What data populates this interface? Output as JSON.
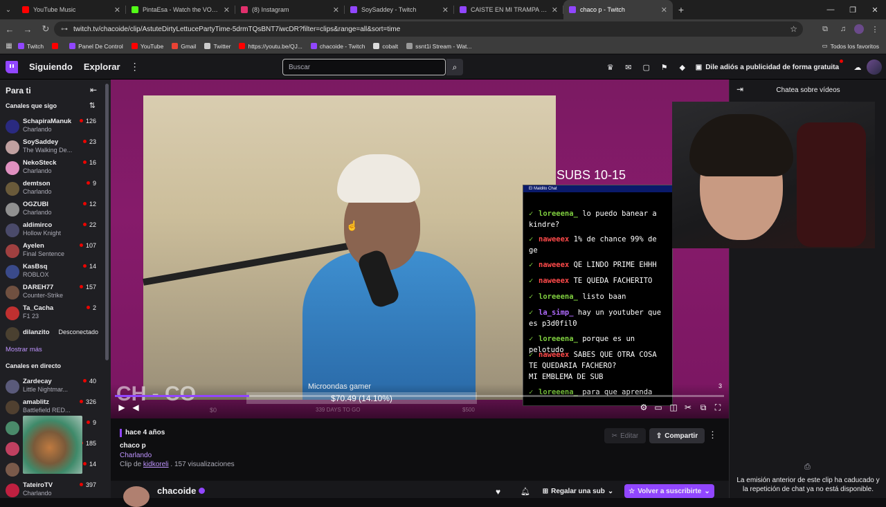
{
  "browser": {
    "tabs": [
      {
        "title": "YouTube Music",
        "color": "#ff0000"
      },
      {
        "title": "PintaEsa - Watch the VOD on K",
        "color": "#53fc18"
      },
      {
        "title": "(8) Instagram",
        "color": "#e1306c"
      },
      {
        "title": "SoySaddey - Twitch",
        "color": "#9146ff"
      },
      {
        "title": "CAISTE EN MI TRAMPA PERRA",
        "color": "#9146ff"
      },
      {
        "title": "chaco p - Twitch",
        "color": "#9146ff",
        "active": true
      }
    ],
    "url": "twitch.tv/chacoide/clip/AstuteDirtyLettucePartyTime-5drmTQsBNT7iwcDR?filter=clips&range=all&sort=time",
    "bookmarks": [
      {
        "label": "Twitch",
        "color": "#9146ff"
      },
      {
        "label": "",
        "color": "#ff0000"
      },
      {
        "label": "Panel De Control",
        "color": "#9146ff"
      },
      {
        "label": "YouTube",
        "color": "#ff0000"
      },
      {
        "label": "Gmail",
        "color": "#ea4335"
      },
      {
        "label": "Twitter",
        "color": "#cccccc"
      },
      {
        "label": "https://youtu.be/QJ...",
        "color": "#ff0000"
      },
      {
        "label": "chacoide - Twitch",
        "color": "#9146ff"
      },
      {
        "label": "cobalt",
        "color": "#dddddd"
      },
      {
        "label": "ssnt1i Stream - Wat...",
        "color": "#999999"
      }
    ],
    "all_favorites": "Todos los favoritos"
  },
  "topnav": {
    "following": "Siguiendo",
    "browse": "Explorar",
    "search_placeholder": "Buscar",
    "ad_free": "Dile adiós a publicidad de forma gratuita"
  },
  "sidebar": {
    "title": "Para ti",
    "followed_title": "Canales que sigo",
    "followed": [
      {
        "name": "SchapiraManuk",
        "game": "Charlando",
        "viewers": "126",
        "color": "#2a2a80"
      },
      {
        "name": "SoySaddey",
        "game": "The Walking De...",
        "viewers": "23",
        "color": "#c0a0a0"
      },
      {
        "name": "NekoSteck",
        "game": "Charlando",
        "viewers": "16",
        "color": "#e090c0"
      },
      {
        "name": "demtson",
        "game": "Charlando",
        "viewers": "9",
        "color": "#6a5a3a"
      },
      {
        "name": "OGZUBI",
        "game": "Charlando",
        "viewers": "12",
        "color": "#909090"
      },
      {
        "name": "aldimirco",
        "game": "Hollow Knight",
        "viewers": "22",
        "color": "#4a4a6a"
      },
      {
        "name": "Ayelen",
        "game": "Final Sentence",
        "viewers": "107",
        "color": "#a04040"
      },
      {
        "name": "KasBsq",
        "game": "ROBLOX",
        "viewers": "14",
        "color": "#3a4a8a"
      },
      {
        "name": "DAREH77",
        "game": "Counter-Strike",
        "viewers": "157",
        "color": "#705040"
      },
      {
        "name": "Ta_Cacha",
        "game": "F1 23",
        "viewers": "2",
        "color": "#c03030"
      }
    ],
    "offline_channel": {
      "name": "dilanzito",
      "status": "Desconectado"
    },
    "show_more": "Mostrar más",
    "live_title": "Canales en directo",
    "live": [
      {
        "name": "Zardecay",
        "game": "Little Nightmar...",
        "viewers": "40",
        "color": "#5a5a7a"
      },
      {
        "name": "amablitz",
        "game": "Battlefield RED...",
        "viewers": "326",
        "color": "#504030"
      },
      {
        "name": "",
        "game": "",
        "viewers": "9",
        "color": "#4a8a6a"
      },
      {
        "name": "",
        "game": "",
        "viewers": "185",
        "color": "#c04060"
      },
      {
        "name": "",
        "game": "",
        "viewers": "14",
        "color": "#7a5a4a"
      },
      {
        "name": "TateiroTV",
        "game": "Charlando",
        "viewers": "397",
        "color": "#c02040"
      }
    ]
  },
  "player": {
    "subs_text": "SUBS 10-15",
    "chat_window_title": "El Maldito Chat",
    "chat_lines": [
      {
        "user": "loreeena_",
        "text": "lo puedo banear a\nkindre?",
        "user_color": "#7fcf3f"
      },
      {
        "user": "naweeex",
        "text": "1% de chance 99% de\nge",
        "user_color": "#ff4a4a"
      },
      {
        "user": "naweeex",
        "text": "QE LINDO PRIME EHHH",
        "user_color": "#ff4a4a"
      },
      {
        "user": "naweeex",
        "text": "TE QUEDA FACHERITO",
        "user_color": "#ff4a4a"
      },
      {
        "user": "loreeena_",
        "text": "listo baan",
        "user_color": "#7fcf3f"
      },
      {
        "user": "la_simp_",
        "text": "hay un youtuber que\nes p3d0fil0",
        "user_color": "#b06aff"
      },
      {
        "user": "loreeena_",
        "text": "porque es un pelotudo",
        "user_color": "#7fcf3f"
      },
      {
        "user": "naweeex",
        "text": "SABES QUE OTRA COSA\nTE QUEDARIA FACHERO?\nMI EMBLEMA DE SUB",
        "user_color": "#ff4a4a"
      },
      {
        "user": "loreeena_",
        "text": "para que aprenda",
        "user_color": "#7fcf3f"
      }
    ],
    "overlay_logo": "CH - CO",
    "goal_name": "Microondas gamer",
    "goal_amount": "$70.49 (14.10%)",
    "goal_fraction": 0.141,
    "goal_days": "339 DAYS TO GO",
    "goal_min": "$0",
    "goal_max": "$500",
    "playback_fraction": 0.22,
    "counter": "3"
  },
  "clip": {
    "ago": "hace 4 años",
    "channel": "chaco p",
    "game": "Charlando",
    "by_prefix": "Clip de",
    "by_user": "kidkoreli",
    "views": ". 157 visualizaciones",
    "edit": "Editar",
    "share": "Compartir"
  },
  "channel_strip": {
    "name": "chacoide",
    "gift": "Regalar una sub",
    "subscribe": "Volver a suscribirte"
  },
  "chat": {
    "title": "Chatea sobre vídeos",
    "expired_msg": "La emisión anterior de este clip ha caducado y la repetición de chat ya no está disponible."
  }
}
